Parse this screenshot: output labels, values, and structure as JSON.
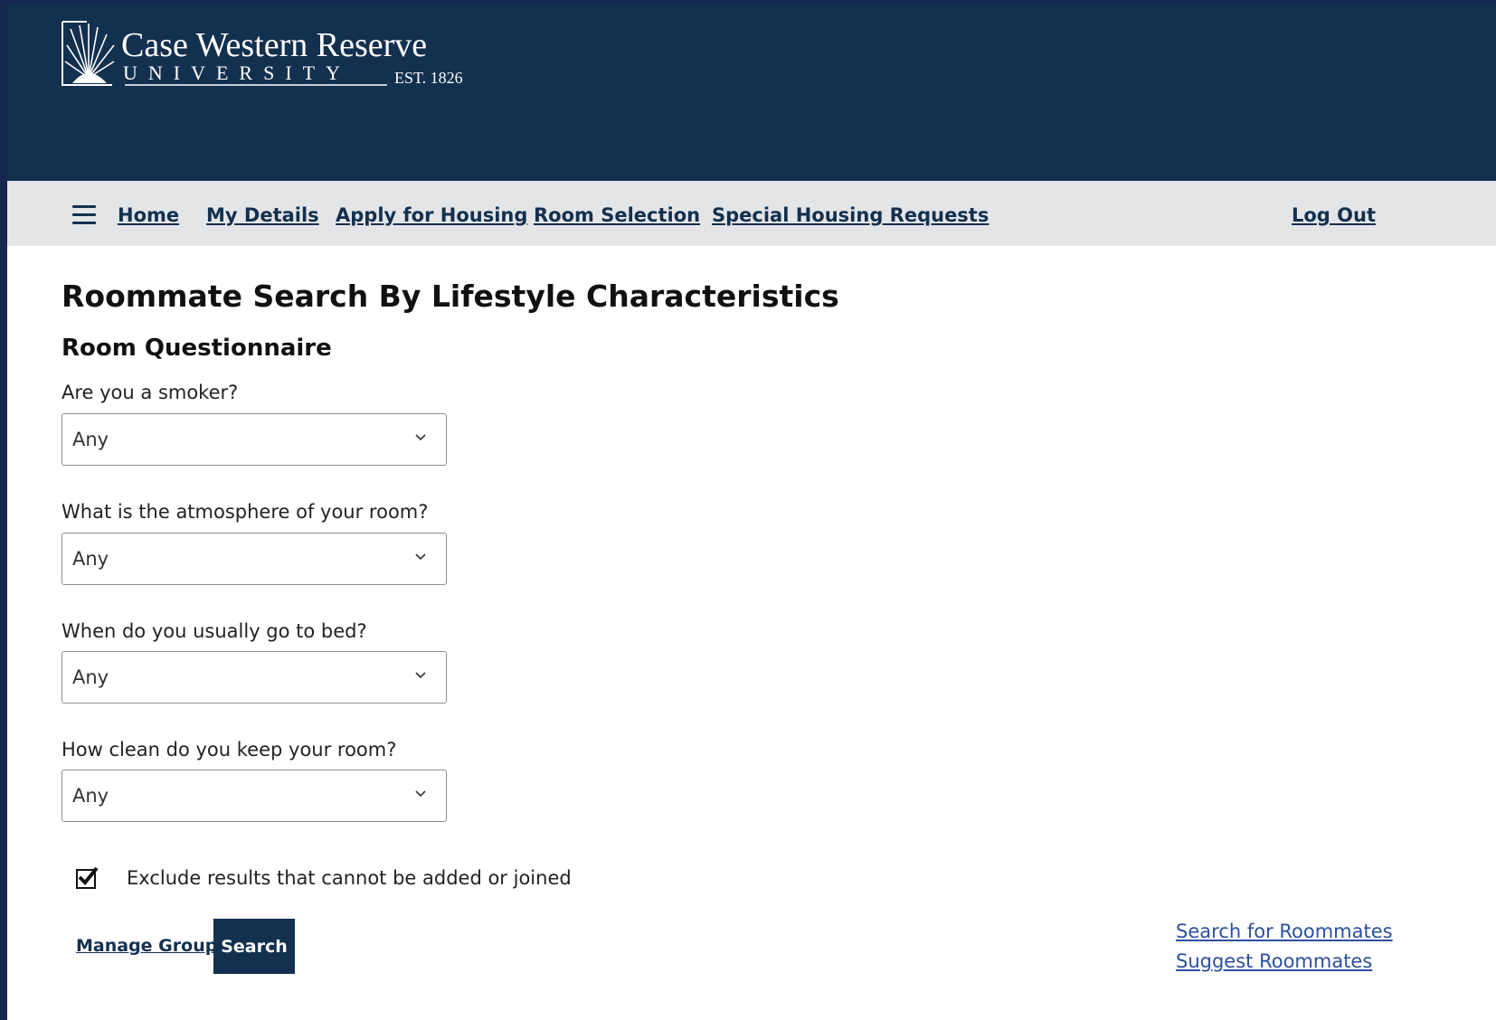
{
  "header": {
    "logo_line1": "Case Western Reserve",
    "logo_line2": "UNIVERSITY",
    "logo_est": "EST. 1826"
  },
  "nav": {
    "home": "Home",
    "my_details": "My Details",
    "apply_for_housing": "Apply for Housing",
    "room_selection": "Room Selection",
    "special_housing_requests": "Special Housing Requests",
    "log_out": "Log Out"
  },
  "main": {
    "title": "Roommate Search By Lifestyle Characteristics",
    "section_title": "Room Questionnaire",
    "questions": [
      {
        "label": "Are you a smoker?",
        "value": "Any"
      },
      {
        "label": "What is the atmosphere of your room?",
        "value": "Any"
      },
      {
        "label": "When do you usually go to bed?",
        "value": "Any"
      },
      {
        "label": "How clean do you keep your room?",
        "value": "Any"
      }
    ],
    "exclude_checkbox": {
      "label": "Exclude results that cannot be added or joined",
      "checked": true
    },
    "manage_group_label": "Manage Group",
    "search_label": "Search"
  },
  "side_links": {
    "search_for_roommates": "Search for Roommates",
    "suggest_roommates": "Suggest Roommates"
  },
  "colors": {
    "brand_navy": "#13304f",
    "nav_bg": "#e4e5e7",
    "link_blue": "#2c4f9e"
  }
}
